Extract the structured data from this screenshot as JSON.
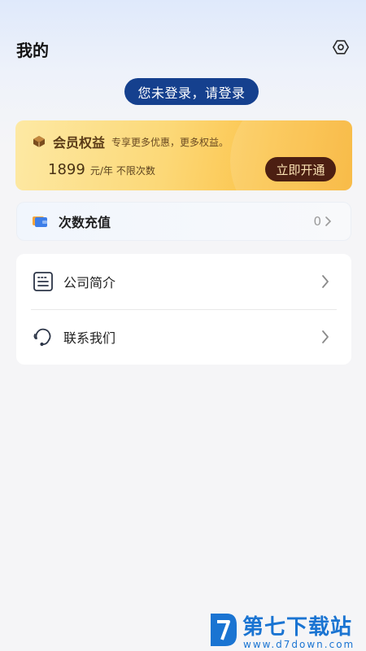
{
  "header": {
    "title": "我的"
  },
  "login": {
    "label": "您未登录，请登录"
  },
  "vip": {
    "title": "会员权益",
    "desc": "专享更多优惠，更多权益。",
    "price": "1899",
    "unit": "元/年",
    "limit": "不限次数",
    "button": "立即开通"
  },
  "recharge": {
    "label": "次数充值",
    "count": "0"
  },
  "menu": {
    "items": [
      {
        "label": "公司简介"
      },
      {
        "label": "联系我们"
      }
    ]
  },
  "watermark": {
    "title": "第七下载站",
    "url": "www.d7down.com"
  },
  "colors": {
    "login_bg": "#15408e",
    "vip_button_bg": "#4c1f12",
    "vip_gold": "#fbc34a",
    "watermark_blue": "#1a74d2"
  }
}
